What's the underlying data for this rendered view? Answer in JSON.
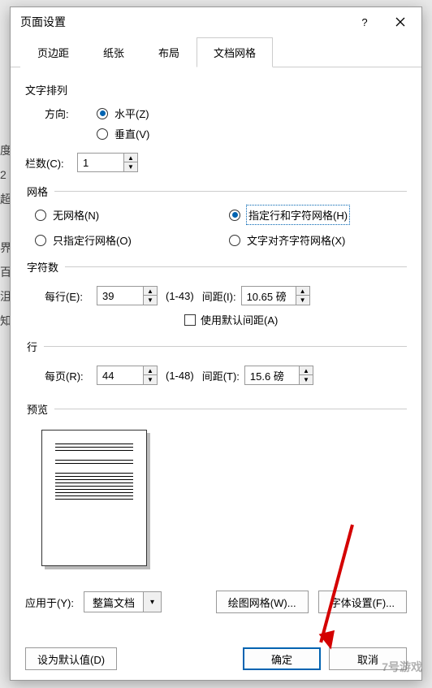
{
  "dialog_title": "页面设置",
  "tabs": [
    "页边距",
    "纸张",
    "布局",
    "文档网格"
  ],
  "active_tab": 3,
  "text_direction": {
    "section": "文字排列",
    "label": "方向:",
    "horizontal": "水平(Z)",
    "vertical": "垂直(V)",
    "selected": "horizontal"
  },
  "columns": {
    "label": "栏数(C):",
    "value": "1"
  },
  "grid_section": "网格",
  "grid_options": {
    "none": "无网格(N)",
    "line_char": "指定行和字符网格(H)",
    "line_only": "只指定行网格(O)",
    "char_align": "文字对齐字符网格(X)",
    "selected": "line_char"
  },
  "char_section": "字符数",
  "per_line": {
    "label": "每行(E):",
    "value": "39",
    "range": "(1-43)"
  },
  "char_spacing": {
    "label": "间距(I):",
    "value": "10.65 磅"
  },
  "use_default_spacing": "使用默认间距(A)",
  "line_section": "行",
  "per_page": {
    "label": "每页(R):",
    "value": "44",
    "range": "(1-48)"
  },
  "line_spacing": {
    "label": "间距(T):",
    "value": "15.6 磅"
  },
  "preview_label": "预览",
  "apply_to": {
    "label": "应用于(Y):",
    "value": "整篇文档"
  },
  "drawing_grid_btn": "绘图网格(W)...",
  "font_settings_btn": "字体设置(F)...",
  "set_default_btn": "设为默认值(D)",
  "ok_btn": "确定",
  "cancel_btn": "取消",
  "watermark": "7号游戏"
}
